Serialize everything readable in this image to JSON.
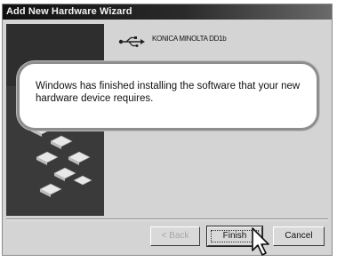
{
  "window": {
    "title": "Add New Hardware Wizard"
  },
  "device": {
    "icon": "usb-icon",
    "name": "KONICA MINOLTA DD1b"
  },
  "message": "Windows has finished installing the software that your new hardware device requires.",
  "buttons": {
    "back_label": "< Back",
    "finish_label": "Finish",
    "cancel_label": "Cancel"
  },
  "icons": {
    "side_panel": "wizard-illustration",
    "pointer": "mouse-cursor-icon"
  }
}
